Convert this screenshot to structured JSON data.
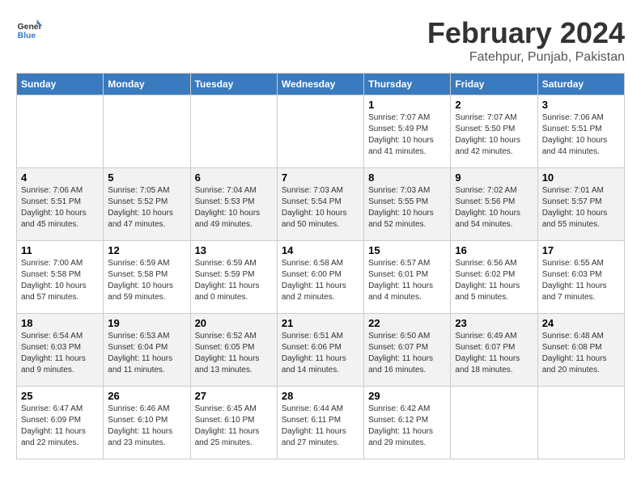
{
  "header": {
    "logo_line1": "General",
    "logo_line2": "Blue",
    "month": "February 2024",
    "location": "Fatehpur, Punjab, Pakistan"
  },
  "days_of_week": [
    "Sunday",
    "Monday",
    "Tuesday",
    "Wednesday",
    "Thursday",
    "Friday",
    "Saturday"
  ],
  "weeks": [
    [
      {
        "day": "",
        "info": ""
      },
      {
        "day": "",
        "info": ""
      },
      {
        "day": "",
        "info": ""
      },
      {
        "day": "",
        "info": ""
      },
      {
        "day": "1",
        "info": "Sunrise: 7:07 AM\nSunset: 5:49 PM\nDaylight: 10 hours and 41 minutes."
      },
      {
        "day": "2",
        "info": "Sunrise: 7:07 AM\nSunset: 5:50 PM\nDaylight: 10 hours and 42 minutes."
      },
      {
        "day": "3",
        "info": "Sunrise: 7:06 AM\nSunset: 5:51 PM\nDaylight: 10 hours and 44 minutes."
      }
    ],
    [
      {
        "day": "4",
        "info": "Sunrise: 7:06 AM\nSunset: 5:51 PM\nDaylight: 10 hours and 45 minutes."
      },
      {
        "day": "5",
        "info": "Sunrise: 7:05 AM\nSunset: 5:52 PM\nDaylight: 10 hours and 47 minutes."
      },
      {
        "day": "6",
        "info": "Sunrise: 7:04 AM\nSunset: 5:53 PM\nDaylight: 10 hours and 49 minutes."
      },
      {
        "day": "7",
        "info": "Sunrise: 7:03 AM\nSunset: 5:54 PM\nDaylight: 10 hours and 50 minutes."
      },
      {
        "day": "8",
        "info": "Sunrise: 7:03 AM\nSunset: 5:55 PM\nDaylight: 10 hours and 52 minutes."
      },
      {
        "day": "9",
        "info": "Sunrise: 7:02 AM\nSunset: 5:56 PM\nDaylight: 10 hours and 54 minutes."
      },
      {
        "day": "10",
        "info": "Sunrise: 7:01 AM\nSunset: 5:57 PM\nDaylight: 10 hours and 55 minutes."
      }
    ],
    [
      {
        "day": "11",
        "info": "Sunrise: 7:00 AM\nSunset: 5:58 PM\nDaylight: 10 hours and 57 minutes."
      },
      {
        "day": "12",
        "info": "Sunrise: 6:59 AM\nSunset: 5:58 PM\nDaylight: 10 hours and 59 minutes."
      },
      {
        "day": "13",
        "info": "Sunrise: 6:59 AM\nSunset: 5:59 PM\nDaylight: 11 hours and 0 minutes."
      },
      {
        "day": "14",
        "info": "Sunrise: 6:58 AM\nSunset: 6:00 PM\nDaylight: 11 hours and 2 minutes."
      },
      {
        "day": "15",
        "info": "Sunrise: 6:57 AM\nSunset: 6:01 PM\nDaylight: 11 hours and 4 minutes."
      },
      {
        "day": "16",
        "info": "Sunrise: 6:56 AM\nSunset: 6:02 PM\nDaylight: 11 hours and 5 minutes."
      },
      {
        "day": "17",
        "info": "Sunrise: 6:55 AM\nSunset: 6:03 PM\nDaylight: 11 hours and 7 minutes."
      }
    ],
    [
      {
        "day": "18",
        "info": "Sunrise: 6:54 AM\nSunset: 6:03 PM\nDaylight: 11 hours and 9 minutes."
      },
      {
        "day": "19",
        "info": "Sunrise: 6:53 AM\nSunset: 6:04 PM\nDaylight: 11 hours and 11 minutes."
      },
      {
        "day": "20",
        "info": "Sunrise: 6:52 AM\nSunset: 6:05 PM\nDaylight: 11 hours and 13 minutes."
      },
      {
        "day": "21",
        "info": "Sunrise: 6:51 AM\nSunset: 6:06 PM\nDaylight: 11 hours and 14 minutes."
      },
      {
        "day": "22",
        "info": "Sunrise: 6:50 AM\nSunset: 6:07 PM\nDaylight: 11 hours and 16 minutes."
      },
      {
        "day": "23",
        "info": "Sunrise: 6:49 AM\nSunset: 6:07 PM\nDaylight: 11 hours and 18 minutes."
      },
      {
        "day": "24",
        "info": "Sunrise: 6:48 AM\nSunset: 6:08 PM\nDaylight: 11 hours and 20 minutes."
      }
    ],
    [
      {
        "day": "25",
        "info": "Sunrise: 6:47 AM\nSunset: 6:09 PM\nDaylight: 11 hours and 22 minutes."
      },
      {
        "day": "26",
        "info": "Sunrise: 6:46 AM\nSunset: 6:10 PM\nDaylight: 11 hours and 23 minutes."
      },
      {
        "day": "27",
        "info": "Sunrise: 6:45 AM\nSunset: 6:10 PM\nDaylight: 11 hours and 25 minutes."
      },
      {
        "day": "28",
        "info": "Sunrise: 6:44 AM\nSunset: 6:11 PM\nDaylight: 11 hours and 27 minutes."
      },
      {
        "day": "29",
        "info": "Sunrise: 6:42 AM\nSunset: 6:12 PM\nDaylight: 11 hours and 29 minutes."
      },
      {
        "day": "",
        "info": ""
      },
      {
        "day": "",
        "info": ""
      }
    ]
  ]
}
